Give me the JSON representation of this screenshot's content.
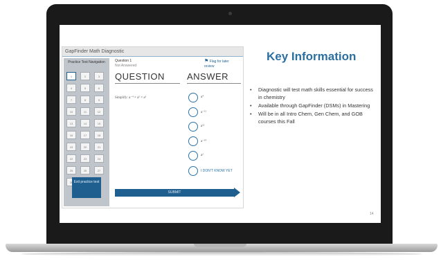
{
  "app": {
    "title": "GapFinder Math Diagnostic",
    "nav_title": "Practice Test Navigation",
    "question_numbers": [
      "1",
      "2",
      "3",
      "4",
      "5",
      "6",
      "7",
      "8",
      "9",
      "10",
      "11",
      "12",
      "13",
      "14",
      "15",
      "16",
      "17",
      "18",
      "19",
      "20",
      "21",
      "22",
      "23",
      "24",
      "25",
      "26",
      "27",
      "28"
    ],
    "active_question": "1",
    "exit_label": "Exit practice test",
    "question_number": "Question 1",
    "question_status": "Not Answered",
    "flag_label": "Flag for later review",
    "question_heading": "QUESTION",
    "answer_heading": "ANSWER",
    "prompt": "Simplify: a⁻⁴ × a⁵ × a³",
    "options": [
      "a⁴",
      "a⁻¹²",
      "a¹²",
      "a⁻¹⁰",
      "a²",
      "I DON'T KNOW YET"
    ],
    "submit_label": "SUBMIT"
  },
  "slide": {
    "title": "Key Information",
    "bullets": [
      "Diagnostic will test math skills essential for success in chemistry",
      "Available through GapFinder (DSMs) in Mastering",
      "Will be in all Intro Chem, Gen Chem, and GOB courses this Fall"
    ],
    "page_number": "14"
  },
  "colors": {
    "accent": "#1f5f8f",
    "title_blue": "#2a6fa0",
    "nav_bg": "#bfc5cb",
    "bezel": "#1a1a1a"
  }
}
